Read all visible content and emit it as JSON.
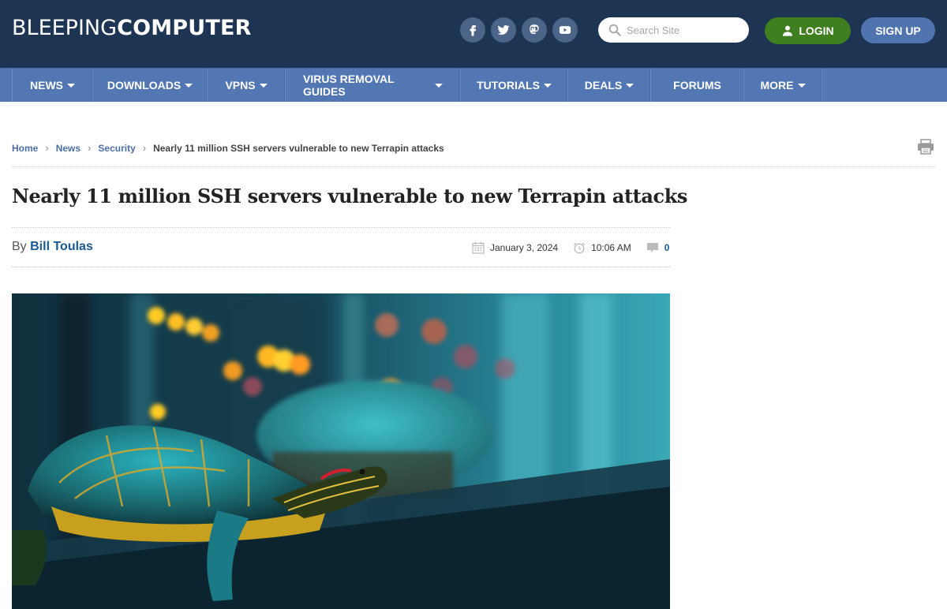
{
  "header": {
    "logo": {
      "light": "BLEEPING",
      "bold": "COMPUTER"
    },
    "social": [
      {
        "name": "facebook",
        "icon": "facebook-icon"
      },
      {
        "name": "twitter",
        "icon": "twitter-icon"
      },
      {
        "name": "mastodon",
        "icon": "mastodon-icon"
      },
      {
        "name": "youtube",
        "icon": "youtube-icon"
      }
    ],
    "search": {
      "placeholder": "Search Site",
      "value": ""
    },
    "login_label": "LOGIN",
    "signup_label": "SIGN UP"
  },
  "nav": {
    "items": [
      {
        "label": "NEWS",
        "dropdown": true
      },
      {
        "label": "DOWNLOADS",
        "dropdown": true
      },
      {
        "label": "VPNS",
        "dropdown": true
      },
      {
        "label": "VIRUS REMOVAL GUIDES",
        "dropdown": true
      },
      {
        "label": "TUTORIALS",
        "dropdown": true
      },
      {
        "label": "DEALS",
        "dropdown": true
      },
      {
        "label": "FORUMS",
        "dropdown": false
      },
      {
        "label": "MORE",
        "dropdown": true
      }
    ]
  },
  "breadcrumb": {
    "items": [
      "Home",
      "News",
      "Security"
    ],
    "current": "Nearly 11 million SSH servers vulnerable to new Terrapin attacks"
  },
  "article": {
    "title": "Nearly 11 million SSH servers vulnerable to new Terrapin attacks",
    "by_label": "By",
    "author": "Bill Toulas",
    "date": "January 3, 2024",
    "time": "10:06 AM",
    "comments": "0",
    "image_alt": "Turtles on server rack with bokeh lights"
  },
  "colors": {
    "header_bg": "#1d3452",
    "nav_bg": "#5277b2",
    "login_bg": "#3f7f20",
    "signup_bg": "#4f74b0",
    "link": "#4b6ea6",
    "author": "#1a5a92"
  }
}
